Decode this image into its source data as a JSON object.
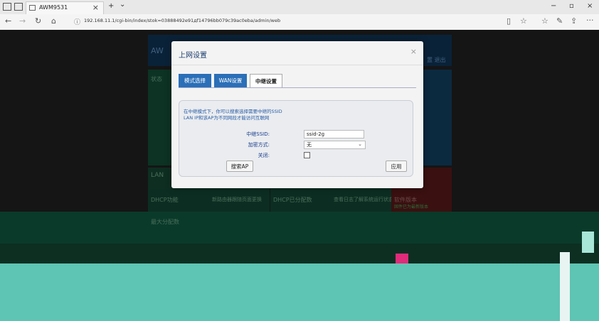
{
  "browser": {
    "tab_title": "AWM9531",
    "new_tab": "+",
    "tab_dropdown": "⌄",
    "tab_close": "×",
    "url": "192.168.11.1/cgi-bin/index/stok=03888492e91дf14796bb079c39ac0eba/admin/web",
    "window_controls": {
      "minimize": "−",
      "maximize": "▫",
      "close": "×"
    },
    "toolbar_glyphs": {
      "back": "←",
      "forward": "→",
      "refresh": "↻",
      "home": "⌂",
      "reading": "▯",
      "favorite": "☆",
      "favorites_hub": "☆",
      "notes": "✎",
      "share": "⇪",
      "more": "···"
    }
  },
  "background_page": {
    "header_left": "AW",
    "header_right": "置 退出",
    "status_label": "状态",
    "lan_label": "LAN",
    "cells": [
      "DHCP功能",
      "新路由器跟随页面更换",
      "DHCP已分配数",
      "查看日志了解系统运行状态",
      "软件版本"
    ],
    "firmware_status": "固件已为最新版本",
    "max_allocation": "最大分配数"
  },
  "modal": {
    "title": "上网设置",
    "close": "×",
    "tabs": [
      {
        "label": "模式选择",
        "style": "blue"
      },
      {
        "label": "WAN设置",
        "style": "blue"
      },
      {
        "label": "中继设置",
        "style": "active"
      }
    ],
    "info_line1": "在中继模式下，你可以搜索选择需要中继的SSID",
    "info_line2": "LAN IP和该AP为不同网段才能访问互联网",
    "ssid_label": "中继SSID:",
    "ssid_value": "ssid-2g",
    "encryption_label": "加密方式:",
    "encryption_value": "无",
    "close_label": "关闭:",
    "close_checked": false,
    "search_button": "搜索AP",
    "apply_button": "应用"
  }
}
